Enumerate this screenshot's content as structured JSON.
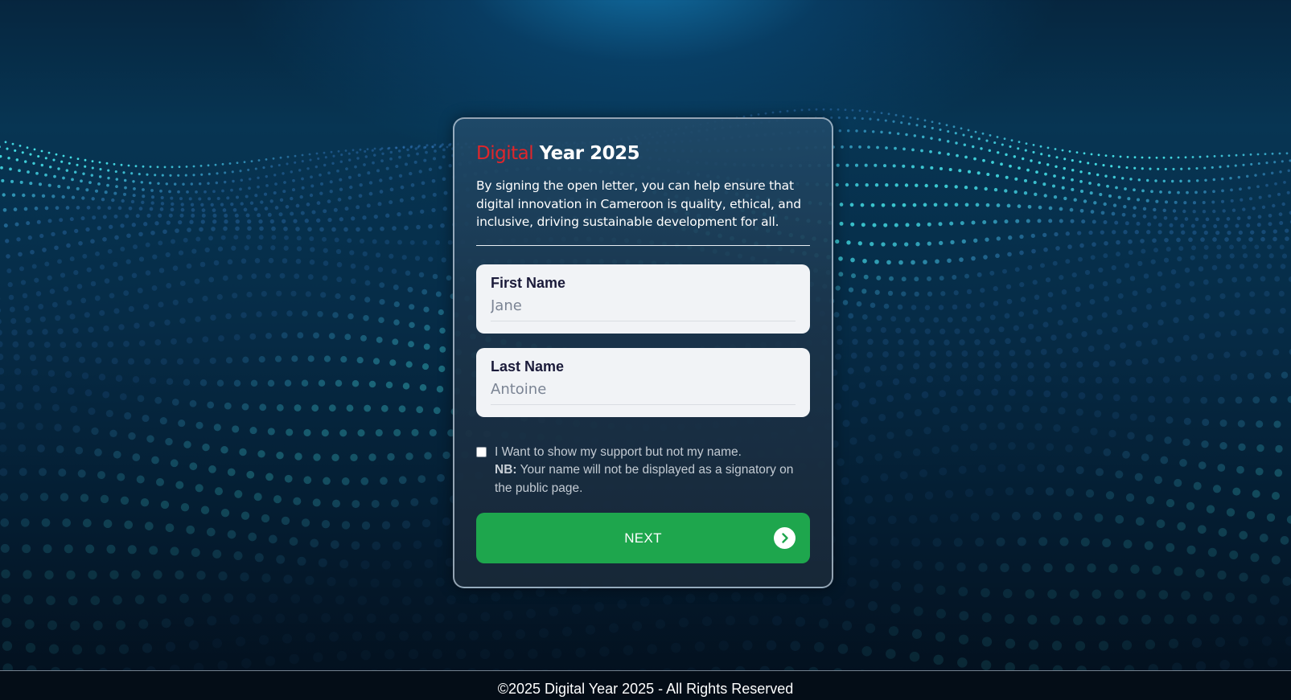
{
  "card": {
    "title_accent": "Digital",
    "title_rest": " Year 2025",
    "intro": "By signing the open letter, you can help ensure that digital innovation in Cameroon is quality, ethical, and inclusive, driving sustainable development for all."
  },
  "form": {
    "first_name": {
      "label": "First Name",
      "placeholder": "Jane"
    },
    "last_name": {
      "label": "Last Name",
      "placeholder": "Antoine"
    },
    "support": {
      "checked": false,
      "text": "I Want to show my support but not my name.",
      "nb_label": "NB:",
      "nb_text": " Your name will not be displayed as a signatory on the public page."
    },
    "next_label": "NEXT",
    "next_icon": "chevron-right-circle-icon"
  },
  "colors": {
    "accent": "#e0262b",
    "button": "#1ea64d",
    "background": "#062c47"
  },
  "footer": {
    "text": "©2025 Digital Year 2025 - All Rights Reserved"
  }
}
